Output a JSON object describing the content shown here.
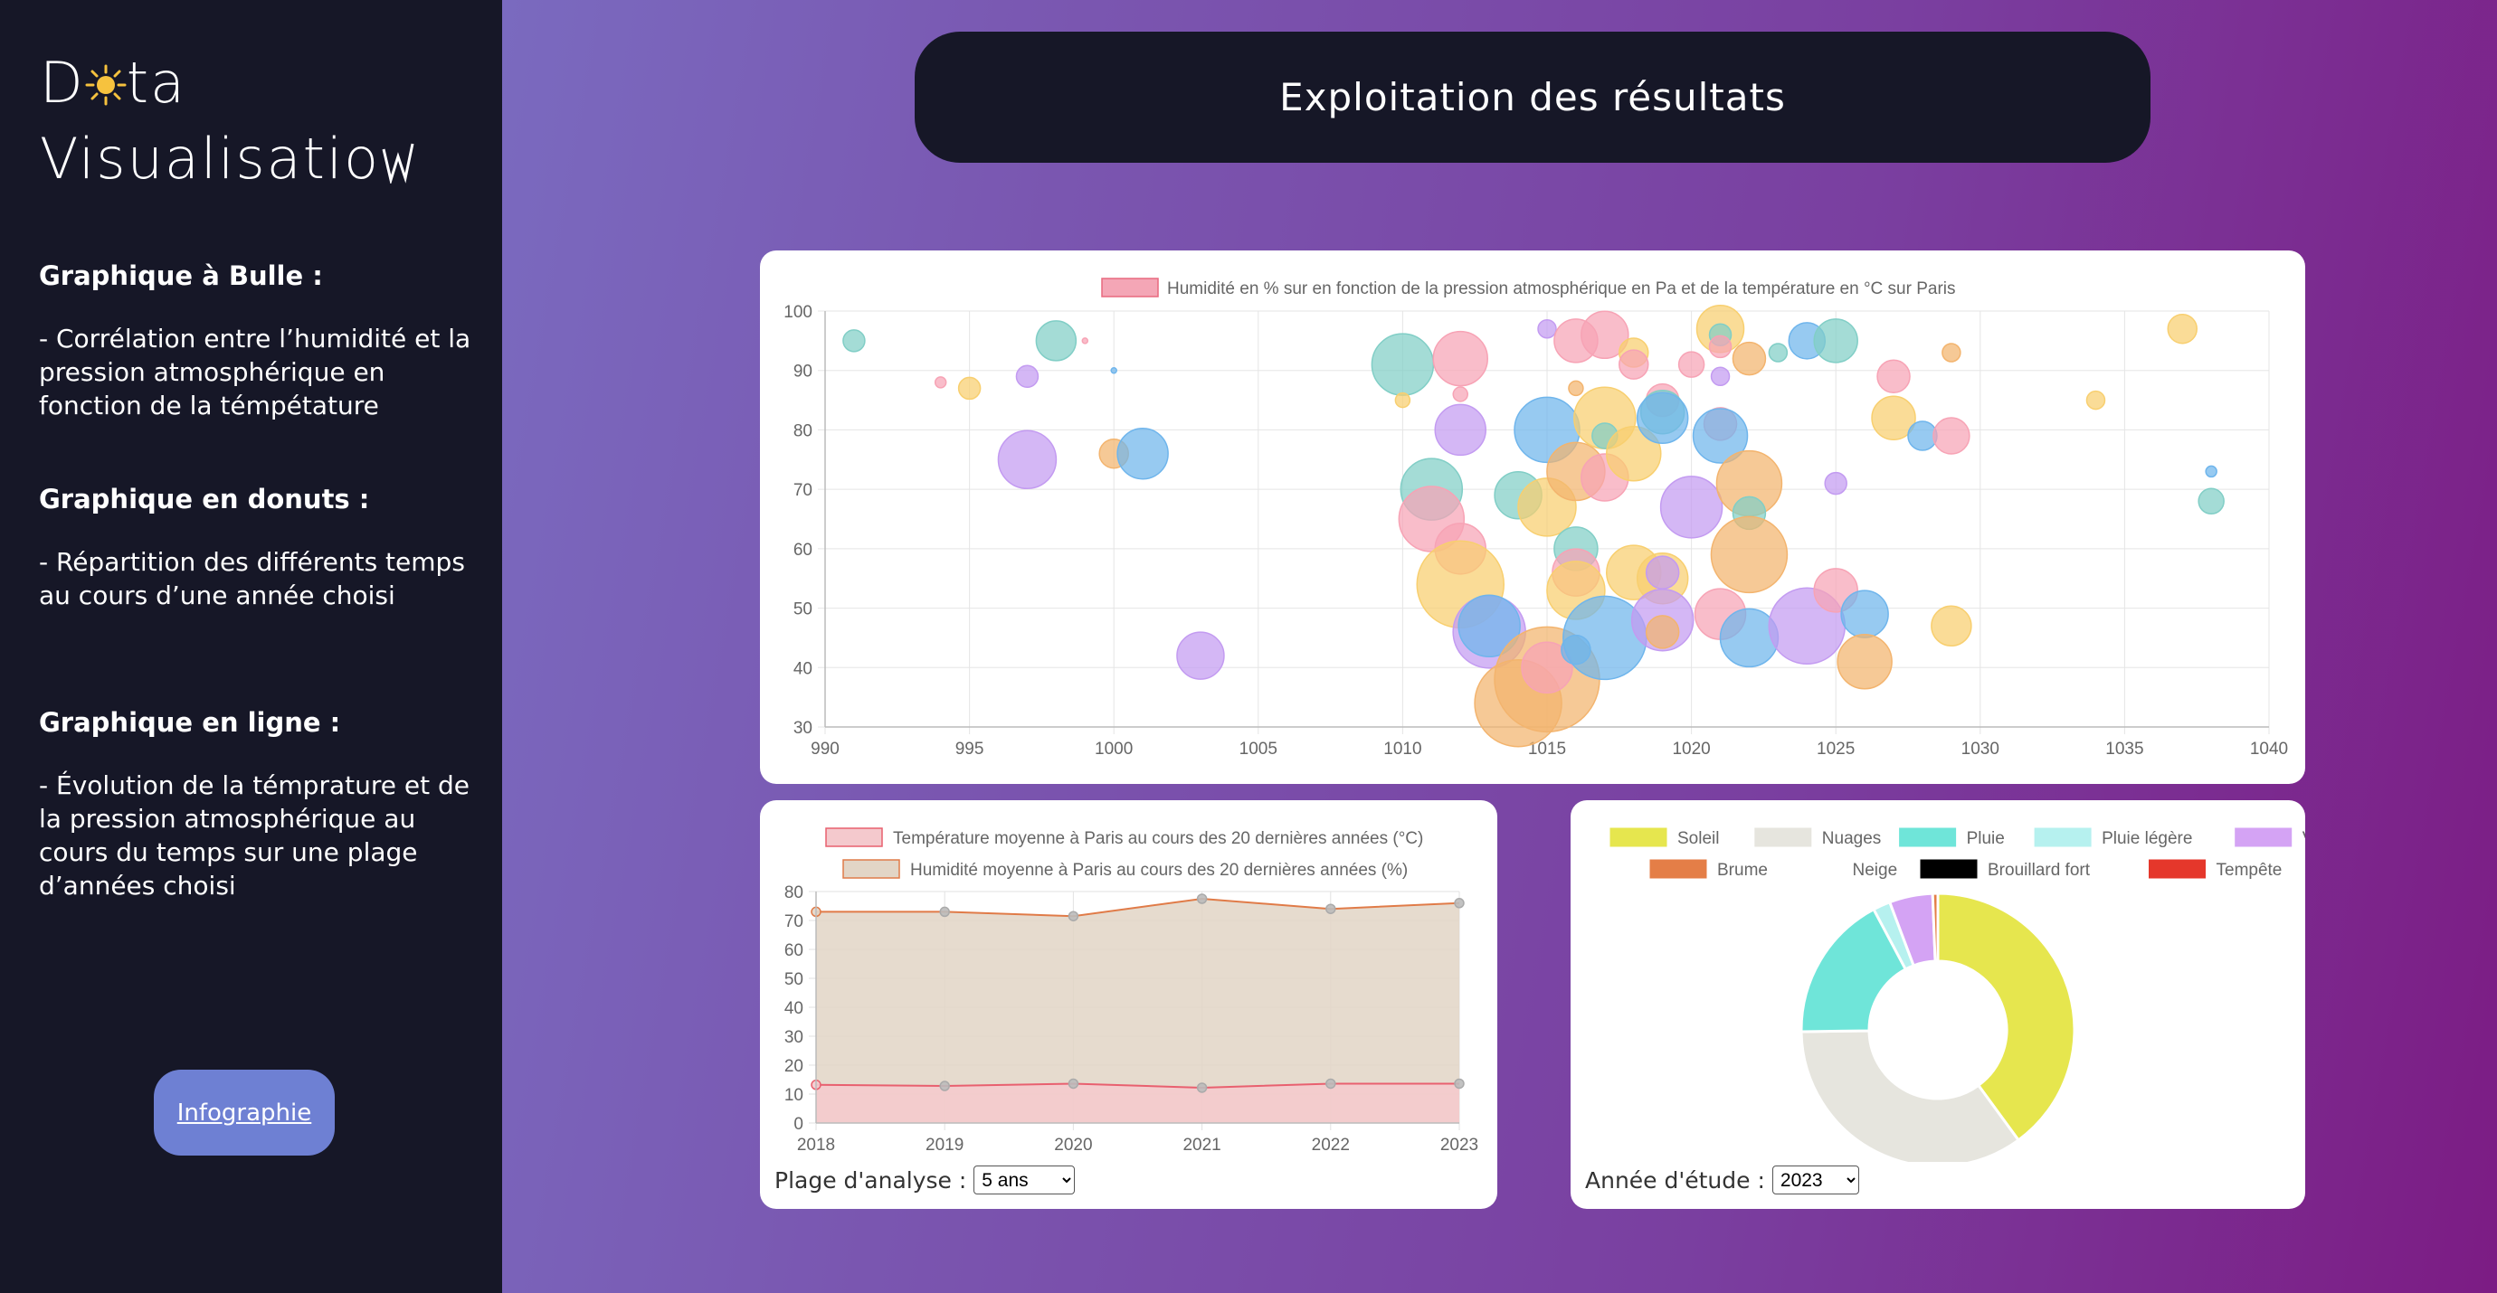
{
  "sidebar": {
    "logo_line1_a": "D",
    "logo_line1_b": "ta",
    "logo_line2": "Visualisatio",
    "sections": [
      {
        "title": "Graphique à Bulle :",
        "desc": "- Corrélation entre l’humidité et la pression atmosphérique en fonction de la témpétature"
      },
      {
        "title": "Graphique en donuts :",
        "desc": "- Répartition des différents temps au cours d’une année choisi"
      },
      {
        "title": "Graphique en ligne :",
        "desc": "- Évolution de la témprature et de la pression atmosphérique au cours du temps sur une plage d’années choisi"
      }
    ],
    "button_label": "Infographie"
  },
  "header": {
    "title": "Exploitation des résultats"
  },
  "colors": {
    "sidebar_bg": "#161727",
    "button_bg": "#6e80d3",
    "bubble_palette": [
      "#f7a3b5",
      "#f8cf6f",
      "#6fb5ec",
      "#81cec6",
      "#f3b46e",
      "#c39bf1"
    ]
  },
  "chart_data": [
    {
      "type": "scatter",
      "title": "Humidité en % sur en fonction de la pression atmosphérique en Pa et de la température en °C sur Paris",
      "legend": "Humidité en % sur en fonction de la pression atmosphérique en Pa et de la température en °C sur Paris",
      "xlim": [
        990,
        1040
      ],
      "ylim": [
        30,
        100
      ],
      "x_ticks": [
        "990",
        "995",
        "1000",
        "1005",
        "1010",
        "1015",
        "1020",
        "1025",
        "1030",
        "1035",
        "1040"
      ],
      "y_ticks": [
        "30",
        "40",
        "50",
        "60",
        "70",
        "80",
        "90",
        "100"
      ],
      "grid": true,
      "legend_position": "top",
      "points": [
        {
          "x": 991,
          "y": 95,
          "r": 6,
          "c": 3
        },
        {
          "x": 994,
          "y": 88,
          "r": 3,
          "c": 0
        },
        {
          "x": 995,
          "y": 87,
          "r": 6,
          "c": 1
        },
        {
          "x": 997,
          "y": 89,
          "r": 6,
          "c": 5
        },
        {
          "x": 997,
          "y": 75,
          "r": 16,
          "c": 5
        },
        {
          "x": 998,
          "y": 95,
          "r": 11,
          "c": 3
        },
        {
          "x": 999,
          "y": 95,
          "r": 1.5,
          "c": 0
        },
        {
          "x": 1000,
          "y": 90,
          "r": 1.5,
          "c": 2
        },
        {
          "x": 1000,
          "y": 76,
          "r": 8,
          "c": 4
        },
        {
          "x": 1001,
          "y": 76,
          "r": 14,
          "c": 2
        },
        {
          "x": 1003,
          "y": 42,
          "r": 13,
          "c": 5
        },
        {
          "x": 1010,
          "y": 91,
          "r": 17,
          "c": 3
        },
        {
          "x": 1010,
          "y": 85,
          "r": 4,
          "c": 1
        },
        {
          "x": 1011,
          "y": 70,
          "r": 17,
          "c": 3
        },
        {
          "x": 1011,
          "y": 65,
          "r": 18,
          "c": 0
        },
        {
          "x": 1012,
          "y": 92,
          "r": 15,
          "c": 0
        },
        {
          "x": 1012,
          "y": 86,
          "r": 4,
          "c": 0
        },
        {
          "x": 1012,
          "y": 80,
          "r": 14,
          "c": 5
        },
        {
          "x": 1012,
          "y": 60,
          "r": 14,
          "c": 0
        },
        {
          "x": 1012,
          "y": 54,
          "r": 24,
          "c": 1
        },
        {
          "x": 1013,
          "y": 46,
          "r": 20,
          "c": 5
        },
        {
          "x": 1013,
          "y": 47,
          "r": 17,
          "c": 2
        },
        {
          "x": 1014,
          "y": 69,
          "r": 13,
          "c": 3
        },
        {
          "x": 1014,
          "y": 34,
          "r": 24,
          "c": 4
        },
        {
          "x": 1015,
          "y": 97,
          "r": 5,
          "c": 5
        },
        {
          "x": 1015,
          "y": 80,
          "r": 18,
          "c": 2
        },
        {
          "x": 1015,
          "y": 67,
          "r": 16,
          "c": 1
        },
        {
          "x": 1015,
          "y": 38,
          "r": 29,
          "c": 4
        },
        {
          "x": 1015,
          "y": 40,
          "r": 14,
          "c": 0
        },
        {
          "x": 1016,
          "y": 95,
          "r": 12,
          "c": 0
        },
        {
          "x": 1016,
          "y": 87,
          "r": 4,
          "c": 4
        },
        {
          "x": 1016,
          "y": 73,
          "r": 16,
          "c": 4
        },
        {
          "x": 1016,
          "y": 60,
          "r": 12,
          "c": 3
        },
        {
          "x": 1016,
          "y": 56,
          "r": 13,
          "c": 0
        },
        {
          "x": 1016,
          "y": 53,
          "r": 16,
          "c": 1
        },
        {
          "x": 1016,
          "y": 43,
          "r": 8,
          "c": 2
        },
        {
          "x": 1017,
          "y": 96,
          "r": 13,
          "c": 0
        },
        {
          "x": 1017,
          "y": 82,
          "r": 17,
          "c": 1
        },
        {
          "x": 1017,
          "y": 79,
          "r": 7,
          "c": 3
        },
        {
          "x": 1017,
          "y": 72,
          "r": 13,
          "c": 0
        },
        {
          "x": 1017,
          "y": 45,
          "r": 23,
          "c": 2
        },
        {
          "x": 1018,
          "y": 93,
          "r": 8,
          "c": 1
        },
        {
          "x": 1018,
          "y": 91,
          "r": 8,
          "c": 0
        },
        {
          "x": 1018,
          "y": 76,
          "r": 15,
          "c": 1
        },
        {
          "x": 1018,
          "y": 56,
          "r": 15,
          "c": 1
        },
        {
          "x": 1019,
          "y": 85,
          "r": 9,
          "c": 0
        },
        {
          "x": 1019,
          "y": 83,
          "r": 12,
          "c": 3
        },
        {
          "x": 1019,
          "y": 82,
          "r": 14,
          "c": 2
        },
        {
          "x": 1019,
          "y": 55,
          "r": 14,
          "c": 1
        },
        {
          "x": 1019,
          "y": 56,
          "r": 9,
          "c": 5
        },
        {
          "x": 1019,
          "y": 48,
          "r": 17,
          "c": 5
        },
        {
          "x": 1019,
          "y": 46,
          "r": 9,
          "c": 4
        },
        {
          "x": 1020,
          "y": 91,
          "r": 7,
          "c": 0
        },
        {
          "x": 1020,
          "y": 67,
          "r": 17,
          "c": 5
        },
        {
          "x": 1021,
          "y": 97,
          "r": 13,
          "c": 1
        },
        {
          "x": 1021,
          "y": 96,
          "r": 6,
          "c": 3
        },
        {
          "x": 1021,
          "y": 94,
          "r": 6,
          "c": 0
        },
        {
          "x": 1021,
          "y": 89,
          "r": 5,
          "c": 5
        },
        {
          "x": 1021,
          "y": 81,
          "r": 9,
          "c": 0
        },
        {
          "x": 1021,
          "y": 79,
          "r": 15,
          "c": 2
        },
        {
          "x": 1021,
          "y": 49,
          "r": 14,
          "c": 0
        },
        {
          "x": 1022,
          "y": 92,
          "r": 9,
          "c": 4
        },
        {
          "x": 1022,
          "y": 71,
          "r": 18,
          "c": 4
        },
        {
          "x": 1022,
          "y": 66,
          "r": 9,
          "c": 3
        },
        {
          "x": 1022,
          "y": 59,
          "r": 21,
          "c": 4
        },
        {
          "x": 1022,
          "y": 45,
          "r": 16,
          "c": 2
        },
        {
          "x": 1023,
          "y": 93,
          "r": 5,
          "c": 3
        },
        {
          "x": 1024,
          "y": 95,
          "r": 10,
          "c": 2
        },
        {
          "x": 1024,
          "y": 47,
          "r": 21,
          "c": 5
        },
        {
          "x": 1025,
          "y": 95,
          "r": 12,
          "c": 3
        },
        {
          "x": 1025,
          "y": 71,
          "r": 6,
          "c": 5
        },
        {
          "x": 1025,
          "y": 53,
          "r": 12,
          "c": 0
        },
        {
          "x": 1026,
          "y": 49,
          "r": 13,
          "c": 2
        },
        {
          "x": 1026,
          "y": 41,
          "r": 15,
          "c": 4
        },
        {
          "x": 1027,
          "y": 89,
          "r": 9,
          "c": 0
        },
        {
          "x": 1027,
          "y": 82,
          "r": 12,
          "c": 1
        },
        {
          "x": 1028,
          "y": 79,
          "r": 8,
          "c": 2
        },
        {
          "x": 1029,
          "y": 93,
          "r": 5,
          "c": 4
        },
        {
          "x": 1029,
          "y": 79,
          "r": 10,
          "c": 0
        },
        {
          "x": 1029,
          "y": 47,
          "r": 11,
          "c": 1
        },
        {
          "x": 1034,
          "y": 85,
          "r": 5,
          "c": 1
        },
        {
          "x": 1037,
          "y": 97,
          "r": 8,
          "c": 1
        },
        {
          "x": 1038,
          "y": 73,
          "r": 3,
          "c": 2
        },
        {
          "x": 1038,
          "y": 68,
          "r": 7,
          "c": 3
        }
      ]
    },
    {
      "type": "area",
      "x": [
        2018,
        2019,
        2020,
        2021,
        2022,
        2023
      ],
      "x_ticks": [
        "2018",
        "2019",
        "2020",
        "2021",
        "2022",
        "2023"
      ],
      "y_ticks": [
        "0",
        "10",
        "20",
        "30",
        "40",
        "50",
        "60",
        "70",
        "80"
      ],
      "ylim": [
        0,
        80
      ],
      "grid": true,
      "legend_position": "top",
      "series": [
        {
          "name": "Température moyenne à Paris au cours des 20 dernières années (°C)",
          "values": [
            13.2,
            12.8,
            13.6,
            12.2,
            13.6,
            13.6
          ],
          "color": "#e8606f",
          "fill": "#f4c9cd"
        },
        {
          "name": "Humidité moyenne à Paris au cours des 20 dernières années (%)",
          "values": [
            73,
            73,
            71.5,
            77.5,
            74,
            76
          ],
          "color": "#e07b48",
          "fill": "#e2d5c6"
        }
      ]
    },
    {
      "type": "pie",
      "legend_position": "top",
      "categories": [
        "Soleil",
        "Nuages",
        "Pluie",
        "Pluie légère",
        "Vent",
        "Brume",
        "Neige",
        "Brouillard fort",
        "Tempête"
      ],
      "values": [
        39,
        34,
        17,
        2,
        5,
        0.6,
        0,
        0,
        0
      ],
      "colors": [
        "#e6e64e",
        "#e6e5de",
        "#6fe5d9",
        "#b6f1ef",
        "#d4a3f4",
        "#e47e47",
        "#ffffff",
        "#000000",
        "#e5372b"
      ]
    }
  ],
  "controls": {
    "range_label": "Plage d'analyse :",
    "range_options": [
      "5 ans"
    ],
    "range_selected": "5 ans",
    "year_label": "Année d'étude :",
    "year_options": [
      "2023"
    ],
    "year_selected": "2023"
  }
}
